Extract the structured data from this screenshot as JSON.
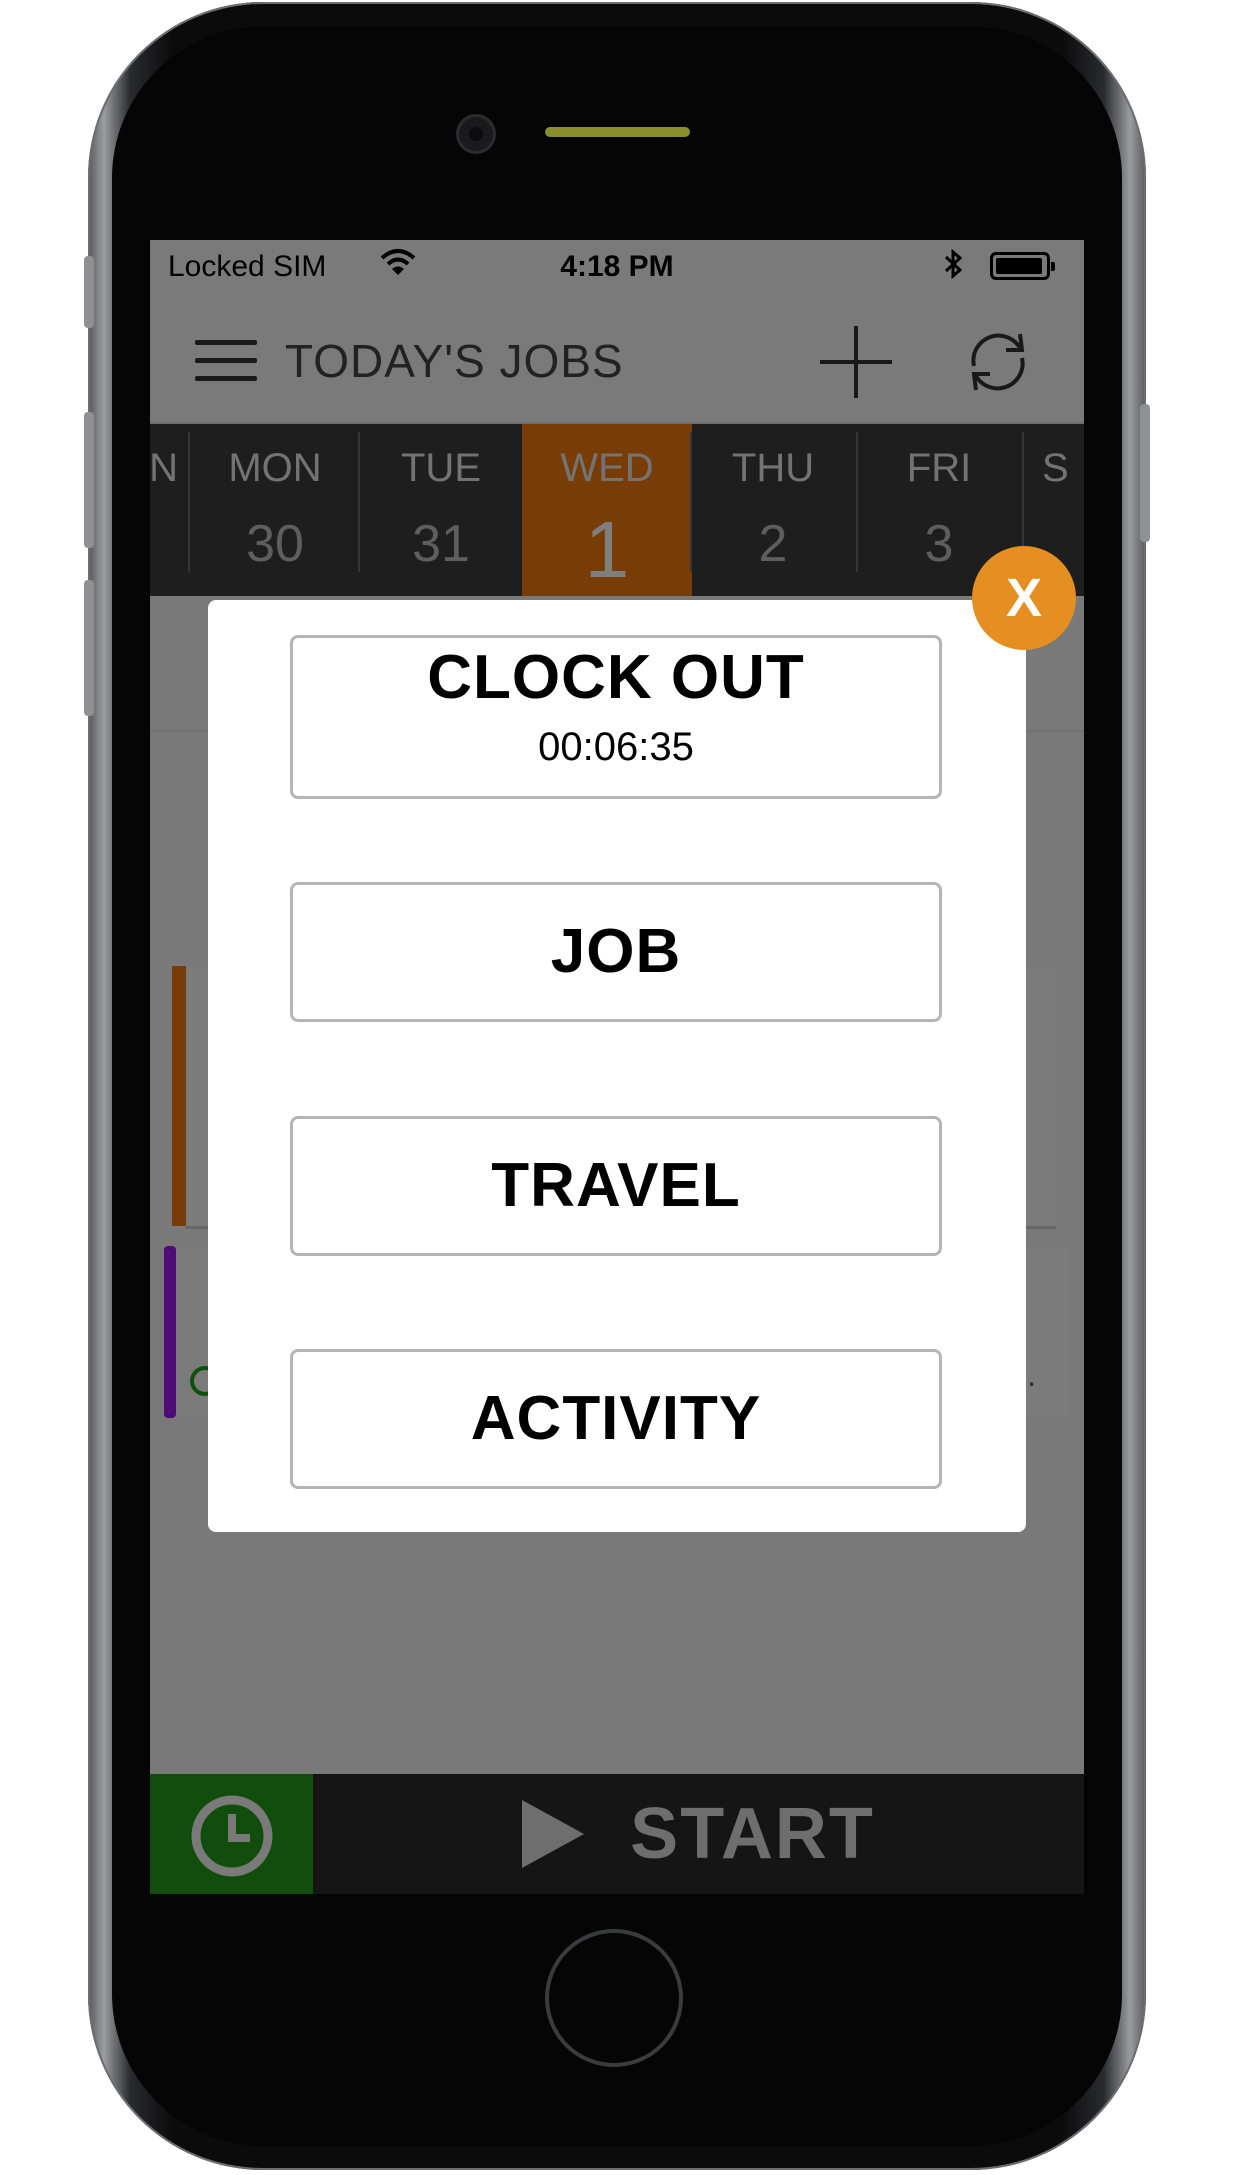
{
  "statusbar": {
    "carrier": "Locked SIM",
    "time": "4:18 PM"
  },
  "header": {
    "title": "TODAY'S JOBS"
  },
  "days": [
    {
      "name": "N",
      "num": ""
    },
    {
      "name": "MON",
      "num": "30"
    },
    {
      "name": "TUE",
      "num": "31"
    },
    {
      "name": "WED",
      "num": "1"
    },
    {
      "name": "THU",
      "num": "2"
    },
    {
      "name": "FRI",
      "num": "3"
    },
    {
      "name": "S",
      "num": ""
    }
  ],
  "colors": {
    "accent": "#f07a0d",
    "clock_green": "#229a19",
    "close_orange": "#e58f23"
  },
  "modal": {
    "clock_out_label": "CLOCK OUT",
    "timer": "00:06:35",
    "job_label": "JOB",
    "travel_label": "TRAVEL",
    "activity_label": "ACTIVITY",
    "close_label": "X"
  },
  "list": {
    "more_label": "..."
  },
  "footer": {
    "start_label": "START"
  }
}
